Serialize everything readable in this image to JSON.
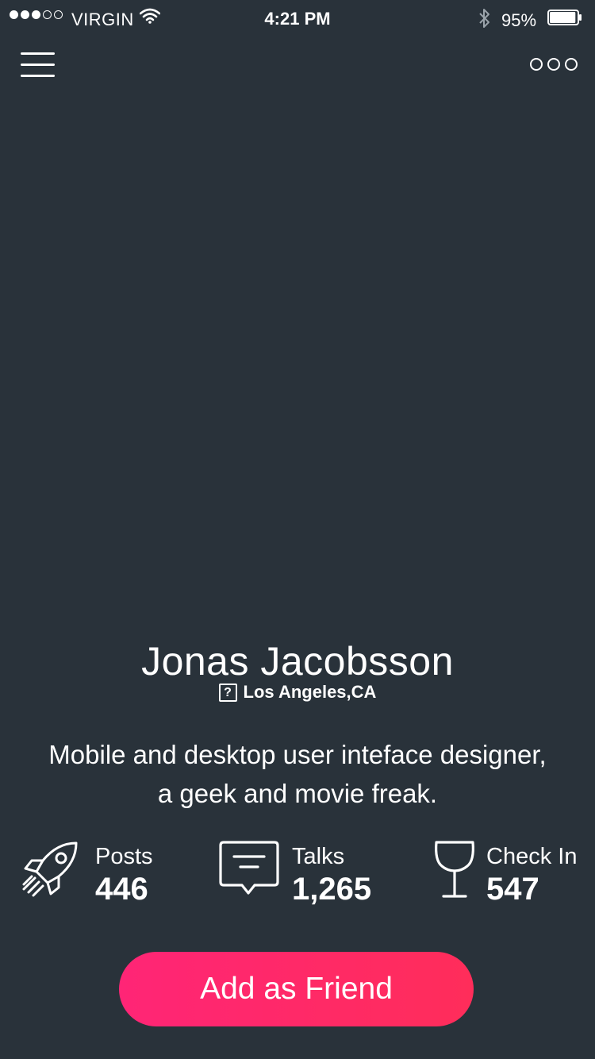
{
  "status_bar": {
    "carrier": "VIRGIN",
    "time": "4:21 PM",
    "battery": "95%",
    "battery_level": 0.95
  },
  "nav": {
    "menu_icon": "hamburger-menu-icon",
    "more_icon": "more-options-icon"
  },
  "profile": {
    "name": "Jonas Jacobsson",
    "location_icon": "?",
    "location": "Los Angeles,CA",
    "bio_line1": "Mobile and desktop user inteface designer,",
    "bio_line2": "a geek and movie freak."
  },
  "stats": [
    {
      "icon": "rocket-icon",
      "label": "Posts",
      "value": "446"
    },
    {
      "icon": "chat-bubble-icon",
      "label": "Talks",
      "value": "1,265"
    },
    {
      "icon": "wine-glass-icon",
      "label": "Check In",
      "value": "547"
    }
  ],
  "actions": {
    "add_friend": "Add as Friend"
  },
  "colors": {
    "background": "#29323a",
    "accent": "#ff2a6a",
    "text": "#ffffff"
  }
}
